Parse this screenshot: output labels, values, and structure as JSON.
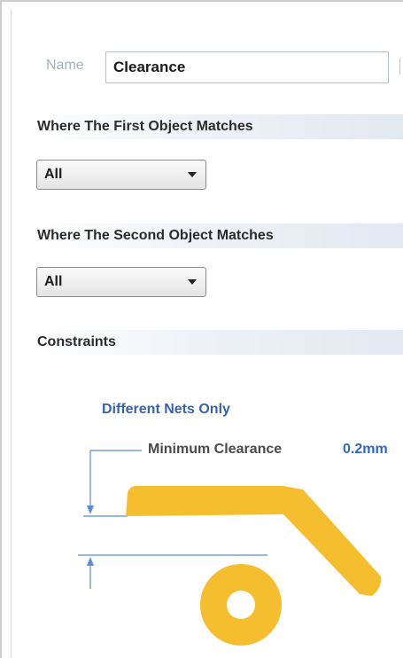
{
  "rule": {
    "name_label": "Name",
    "name_value": "Clearance"
  },
  "first_match": {
    "header": "Where The First Object Matches",
    "selected": "All"
  },
  "second_match": {
    "header": "Where The Second Object Matches",
    "selected": "All"
  },
  "constraints": {
    "header": "Constraints",
    "nets_mode": "Different Nets Only",
    "min_clearance_label": "Minimum Clearance",
    "min_clearance_value": "0.2mm"
  },
  "colors": {
    "copper": "#f5be2e",
    "accent_blue": "#2f67c6",
    "dimension_line": "#5b8bd6"
  }
}
